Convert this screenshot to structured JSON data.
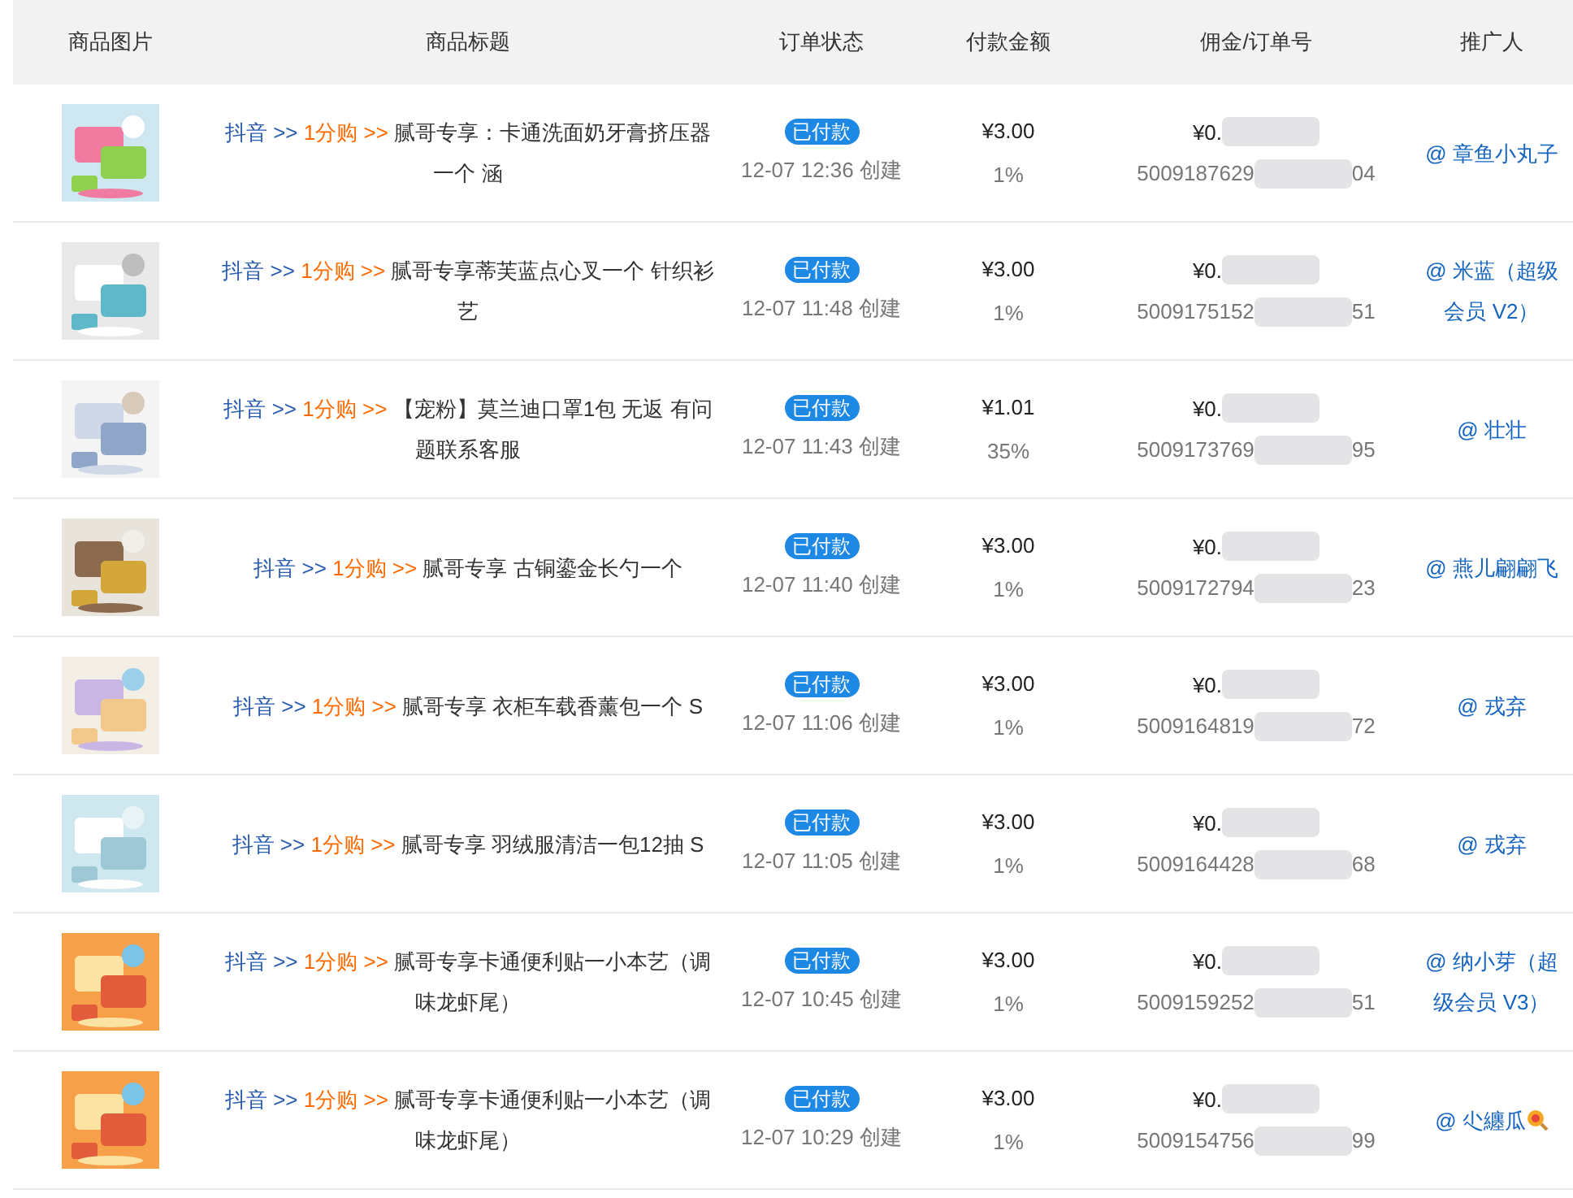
{
  "table": {
    "columns": [
      "商品图片",
      "商品标题",
      "订单状态",
      "付款金额",
      "佣金/订单号",
      "推广人"
    ],
    "rows": [
      {
        "platform": "抖音",
        "platform_sep": ">>",
        "channel": "1分购",
        "channel_sep": ">>",
        "title": "腻哥专享：卡通洗面奶牙膏挤压器一个 涵",
        "status": "已付款",
        "created": "12-07 12:36 创建",
        "amount": "¥3.00",
        "rate": "1%",
        "commission": "¥0.",
        "order_prefix": "5009187629",
        "order_suffix": "04",
        "promoter": "@ 章鱼小丸子",
        "promoter_emoji": false
      },
      {
        "platform": "抖音",
        "platform_sep": ">>",
        "channel": "1分购",
        "channel_sep": ">>",
        "title": "腻哥专享蒂芙蓝点心叉一个 针织衫艺",
        "status": "已付款",
        "created": "12-07 11:48 创建",
        "amount": "¥3.00",
        "rate": "1%",
        "commission": "¥0.",
        "order_prefix": "5009175152",
        "order_suffix": "51",
        "promoter": "@ 米蓝（超级会员 V2）",
        "promoter_emoji": false
      },
      {
        "platform": "抖音",
        "platform_sep": ">>",
        "channel": "1分购",
        "channel_sep": ">>",
        "title": "【宠粉】莫兰迪口罩1包 无返 有问题联系客服",
        "status": "已付款",
        "created": "12-07 11:43 创建",
        "amount": "¥1.01",
        "rate": "35%",
        "commission": "¥0.",
        "order_prefix": "5009173769",
        "order_suffix": "95",
        "promoter": "@ 壮壮",
        "promoter_emoji": false
      },
      {
        "platform": "抖音",
        "platform_sep": ">>",
        "channel": "1分购",
        "channel_sep": ">>",
        "title": "腻哥专享 古铜鎏金长勺一个",
        "status": "已付款",
        "created": "12-07 11:40 创建",
        "amount": "¥3.00",
        "rate": "1%",
        "commission": "¥0.",
        "order_prefix": "5009172794",
        "order_suffix": "23",
        "promoter": "@ 燕儿翩翩飞",
        "promoter_emoji": false
      },
      {
        "platform": "抖音",
        "platform_sep": ">>",
        "channel": "1分购",
        "channel_sep": ">>",
        "title": "腻哥专享 衣柜车载香薰包一个 S",
        "status": "已付款",
        "created": "12-07 11:06 创建",
        "amount": "¥3.00",
        "rate": "1%",
        "commission": "¥0.",
        "order_prefix": "5009164819",
        "order_suffix": "72",
        "promoter": "@ 戎弃",
        "promoter_emoji": false
      },
      {
        "platform": "抖音",
        "platform_sep": ">>",
        "channel": "1分购",
        "channel_sep": ">>",
        "title": "腻哥专享 羽绒服清洁一包12抽 S",
        "status": "已付款",
        "created": "12-07 11:05 创建",
        "amount": "¥3.00",
        "rate": "1%",
        "commission": "¥0.",
        "order_prefix": "5009164428",
        "order_suffix": "68",
        "promoter": "@ 戎弃",
        "promoter_emoji": false
      },
      {
        "platform": "抖音",
        "platform_sep": ">>",
        "channel": "1分购",
        "channel_sep": ">>",
        "title": "腻哥专享卡通便利贴一小本艺（调味龙虾尾）",
        "status": "已付款",
        "created": "12-07 10:45 创建",
        "amount": "¥3.00",
        "rate": "1%",
        "commission": "¥0.",
        "order_prefix": "5009159252",
        "order_suffix": "51",
        "promoter": "@ 纳小芽（超级会员 V3）",
        "promoter_emoji": false
      },
      {
        "platform": "抖音",
        "platform_sep": ">>",
        "channel": "1分购",
        "channel_sep": ">>",
        "title": "腻哥专享卡通便利贴一小本艺（调味龙虾尾）",
        "status": "已付款",
        "created": "12-07 10:29 创建",
        "amount": "¥3.00",
        "rate": "1%",
        "commission": "¥0.",
        "order_prefix": "5009154756",
        "order_suffix": "99",
        "promoter": "@ 尐纏瓜",
        "promoter_emoji": true
      }
    ]
  }
}
